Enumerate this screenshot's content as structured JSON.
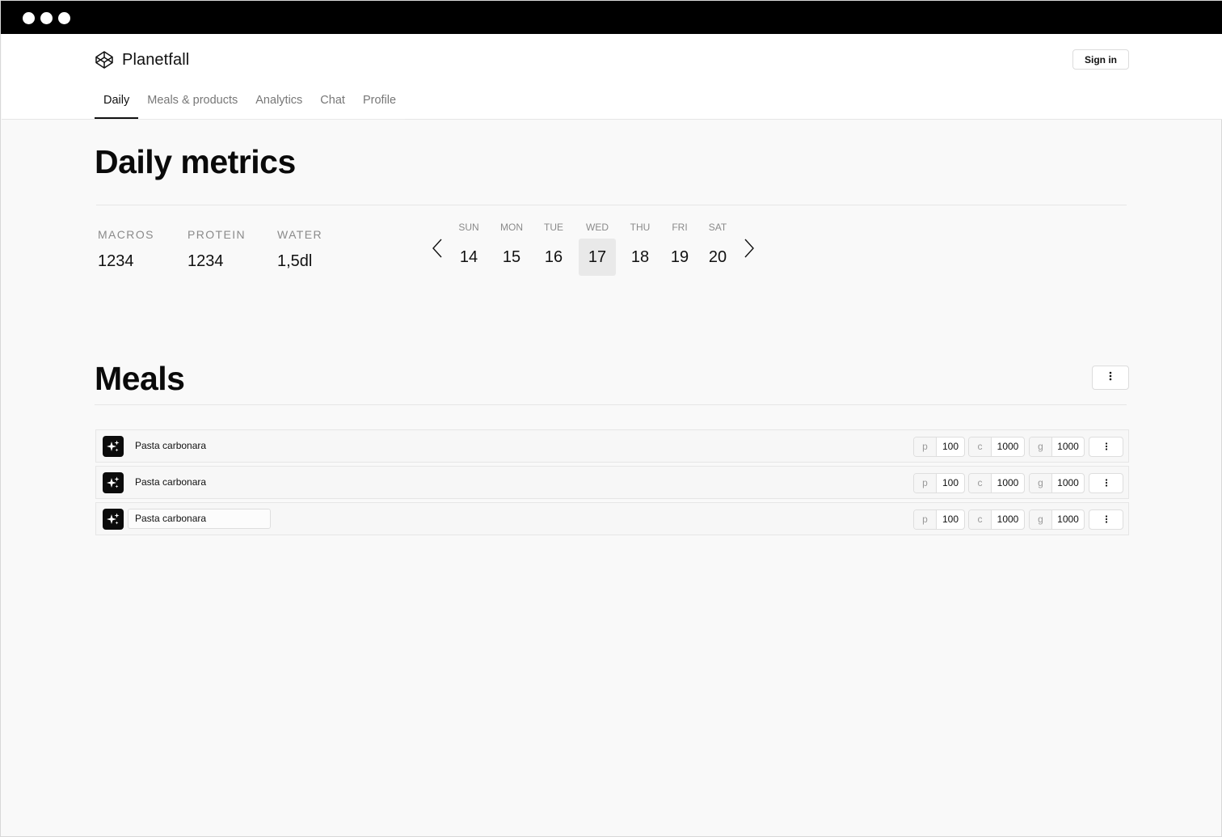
{
  "app": {
    "name": "Planetfall",
    "logo_icon": "codepen-cube-icon",
    "sign_in_label": "Sign in"
  },
  "nav": {
    "tabs": [
      {
        "label": "Daily",
        "active": true
      },
      {
        "label": "Meals & products",
        "active": false
      },
      {
        "label": "Analytics",
        "active": false
      },
      {
        "label": "Chat",
        "active": false
      },
      {
        "label": "Profile",
        "active": false
      }
    ]
  },
  "daily": {
    "title": "Daily metrics",
    "metrics": [
      {
        "label": "MACROS",
        "value": "1234"
      },
      {
        "label": "PROTEIN",
        "value": "1234"
      },
      {
        "label": "WATER",
        "value": "1,5dl"
      }
    ],
    "week": [
      {
        "day": "SUN",
        "date": "14"
      },
      {
        "day": "MON",
        "date": "15"
      },
      {
        "day": "TUE",
        "date": "16"
      },
      {
        "day": "WED",
        "date": "17",
        "selected": true
      },
      {
        "day": "THU",
        "date": "18"
      },
      {
        "day": "FRI",
        "date": "19"
      },
      {
        "day": "SAT",
        "date": "20"
      }
    ]
  },
  "meals": {
    "title": "Meals",
    "items": [
      {
        "name": "Pasta carbonara",
        "p_label": "p",
        "p": "100",
        "c_label": "c",
        "c": "1000",
        "g_label": "g",
        "g": "1000"
      },
      {
        "name": "Pasta carbonara",
        "p_label": "p",
        "p": "100",
        "c_label": "c",
        "c": "1000",
        "g_label": "g",
        "g": "1000"
      },
      {
        "name": "Pasta carbonara",
        "p_label": "p",
        "p": "100",
        "c_label": "c",
        "c": "1000",
        "g_label": "g",
        "g": "1000",
        "editing": true
      }
    ]
  },
  "colors": {
    "background": "#f9f9f9",
    "accent": "#111111",
    "selected_day_bg": "#e9e9e9"
  }
}
